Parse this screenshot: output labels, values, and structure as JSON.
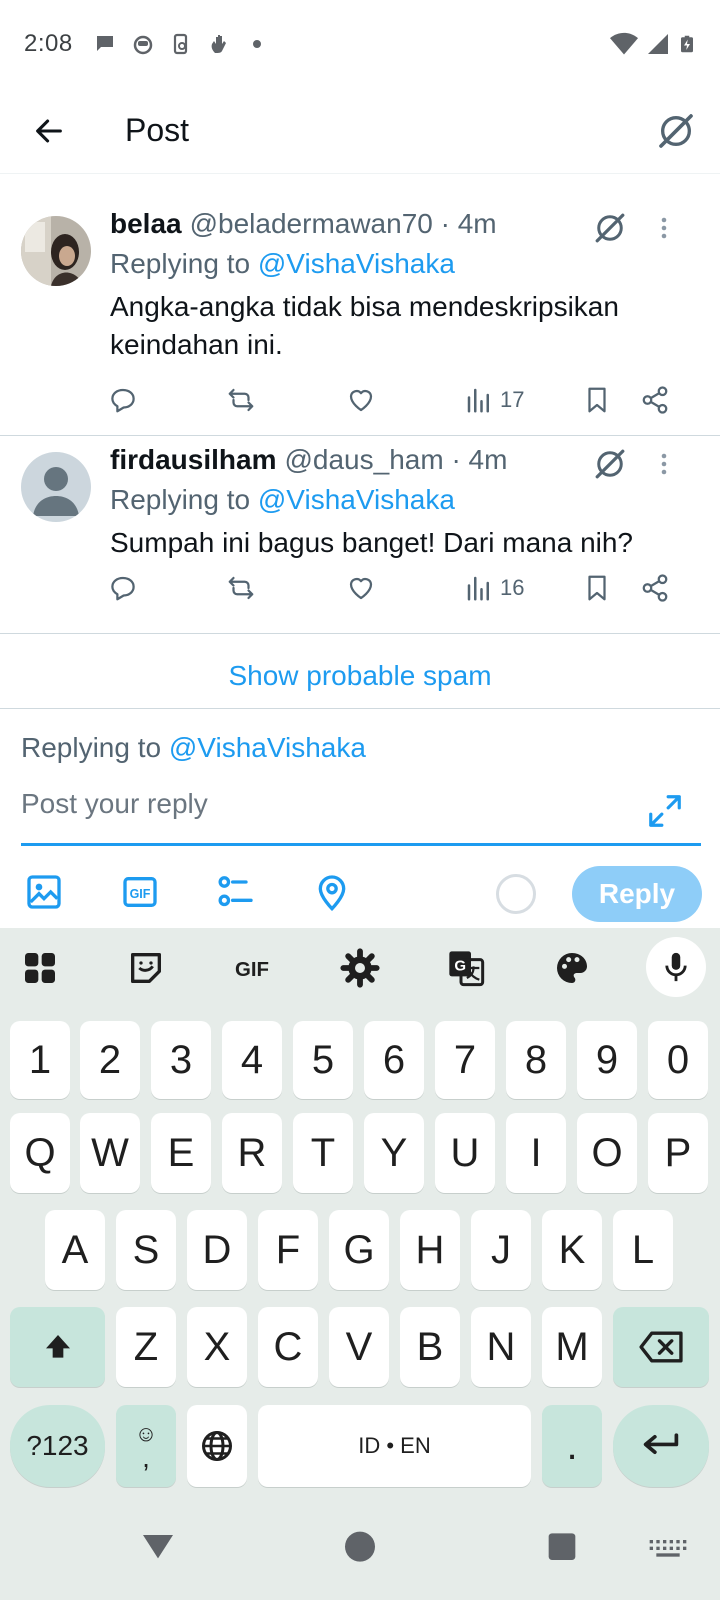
{
  "status_bar": {
    "time": "2:08",
    "notification_icons": [
      "chat-icon",
      "android-face-icon",
      "screen-rotation-icon",
      "hand-icon",
      "dot-icon"
    ],
    "system_icons": [
      "wifi-icon",
      "signal-icon",
      "battery-charging-icon"
    ]
  },
  "header": {
    "title": "Post",
    "back_icon": "arrow-left-icon",
    "grok_icon": "grok-icon"
  },
  "tweets": [
    {
      "name": "belaa",
      "handle": "@beladermawan70 · 4m",
      "replying_prefix": "Replying to ",
      "replying_to": "@VishaVishaka",
      "text": "Angka-angka tidak bisa mendeskripsikan keindahan ini.",
      "views": "17"
    },
    {
      "name": "firdausilham",
      "handle": "@daus_ham · 4m",
      "replying_prefix": "Replying to ",
      "replying_to": "@VishaVishaka",
      "text": "Sumpah ini bagus banget! Dari mana nih?",
      "views": "16"
    }
  ],
  "show_spam": "Show probable spam",
  "compose": {
    "replying_prefix": "Replying to ",
    "replying_to": "@VishaVishaka",
    "placeholder": "Post your reply",
    "reply_button": "Reply"
  },
  "keyboard": {
    "toolbar_icons": [
      "apps-grid-icon",
      "sticker-icon",
      "gif-icon",
      "settings-icon",
      "translate-icon",
      "palette-icon",
      "mic-icon"
    ],
    "gif_label": "GIF",
    "row_numbers": [
      "1",
      "2",
      "3",
      "4",
      "5",
      "6",
      "7",
      "8",
      "9",
      "0"
    ],
    "row_1": [
      "Q",
      "W",
      "E",
      "R",
      "T",
      "Y",
      "U",
      "I",
      "O",
      "P"
    ],
    "row_2": [
      "A",
      "S",
      "D",
      "F",
      "G",
      "H",
      "J",
      "K",
      "L"
    ],
    "row_3": [
      "Z",
      "X",
      "C",
      "V",
      "B",
      "N",
      "M"
    ],
    "symbols_key": "?123",
    "emoji_key_top": "☺",
    "emoji_key_bottom": ",",
    "space_label": "ID • EN",
    "period_key": "."
  },
  "nav_bar": {
    "icons": [
      "back-triangle-icon",
      "home-circle-icon",
      "recents-square-icon",
      "keyboard-switch-icon"
    ]
  },
  "colors": {
    "accent": "#1d9bf0",
    "reply_button_disabled": "#8ecdf8",
    "keyboard_bg": "#e6ece9",
    "keyboard_dark_key": "#c7e5dc"
  }
}
